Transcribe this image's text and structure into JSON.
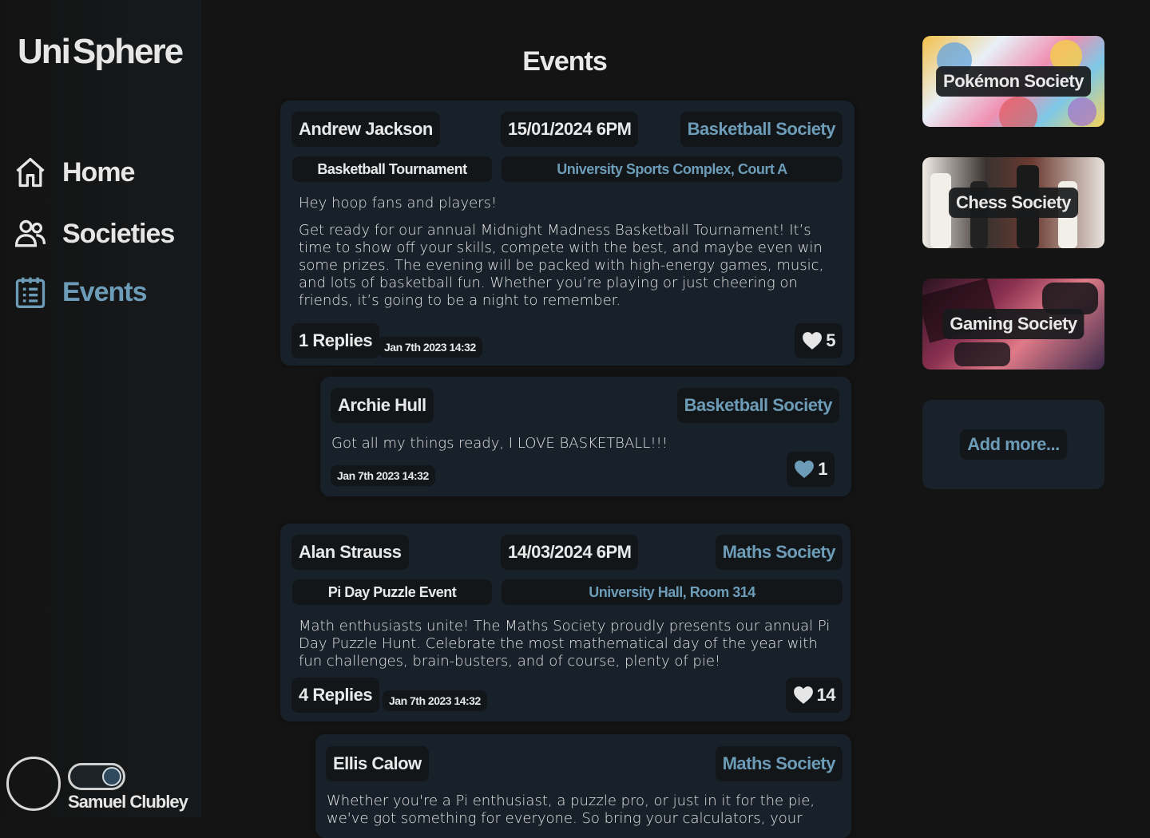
{
  "app": {
    "logo_part1": "Uni",
    "logo_part2": "Sphere"
  },
  "nav": {
    "items": [
      {
        "label": "Home",
        "icon": "home-icon"
      },
      {
        "label": "Societies",
        "icon": "users-icon"
      },
      {
        "label": "Events",
        "icon": "calendar-icon",
        "active": true
      }
    ]
  },
  "user": {
    "name": "Samuel Clubley"
  },
  "page": {
    "title": "Events"
  },
  "events": [
    {
      "author": "Andrew Jackson",
      "date": "15/01/2024 6PM",
      "society": "Basketball Society",
      "event_name": "Basketball Tournament",
      "location": "University Sports Complex, Court A",
      "paragraph1": "Hey hoop fans and players!",
      "paragraph2": "Get ready for our annual Midnight Madness Basketball Tournament! It’s time to show off your skills, compete with the best, and maybe even win some prizes. The evening will be packed with high-energy games, music, and lots of basketball fun. Whether you’re playing or just cheering on friends, it’s going to be a night to remember.",
      "replies": "1 Replies",
      "timestamp": "Jan 7th 2023 14:32",
      "likes": "5",
      "reply": {
        "author": "Archie Hull",
        "society": "Basketball Society",
        "text": "Got all my things ready, I LOVE BASKETBALL!!!",
        "timestamp": "Jan 7th 2023 14:32",
        "likes": "1"
      }
    },
    {
      "author": "Alan Strauss",
      "date": "14/03/2024 6PM",
      "society": "Maths Society",
      "event_name": "Pi Day Puzzle Event",
      "location": "University Hall, Room 314",
      "paragraph1": "Math enthusiasts unite! The Maths Society proudly presents our annual Pi Day Puzzle Hunt. Celebrate the most mathematical day of the year with fun challenges, brain-busters, and of course, plenty of pie!",
      "replies": "4 Replies",
      "timestamp": "Jan 7th 2023 14:32",
      "likes": "14",
      "reply": {
        "author": "Ellis Calow",
        "society": "Maths Society",
        "text": "Whether you're a Pi enthusiast, a puzzle pro, or just in it for the pie, we've got something for everyone. So bring your calculators, your"
      }
    }
  ],
  "societies": [
    {
      "label": "Pokémon Society"
    },
    {
      "label": "Chess Society"
    },
    {
      "label": "Gaming Society"
    }
  ],
  "add_more": {
    "label": "Add more..."
  },
  "colors": {
    "accent": "#6d9cb8",
    "background": "#141414",
    "card": "#18212a"
  }
}
